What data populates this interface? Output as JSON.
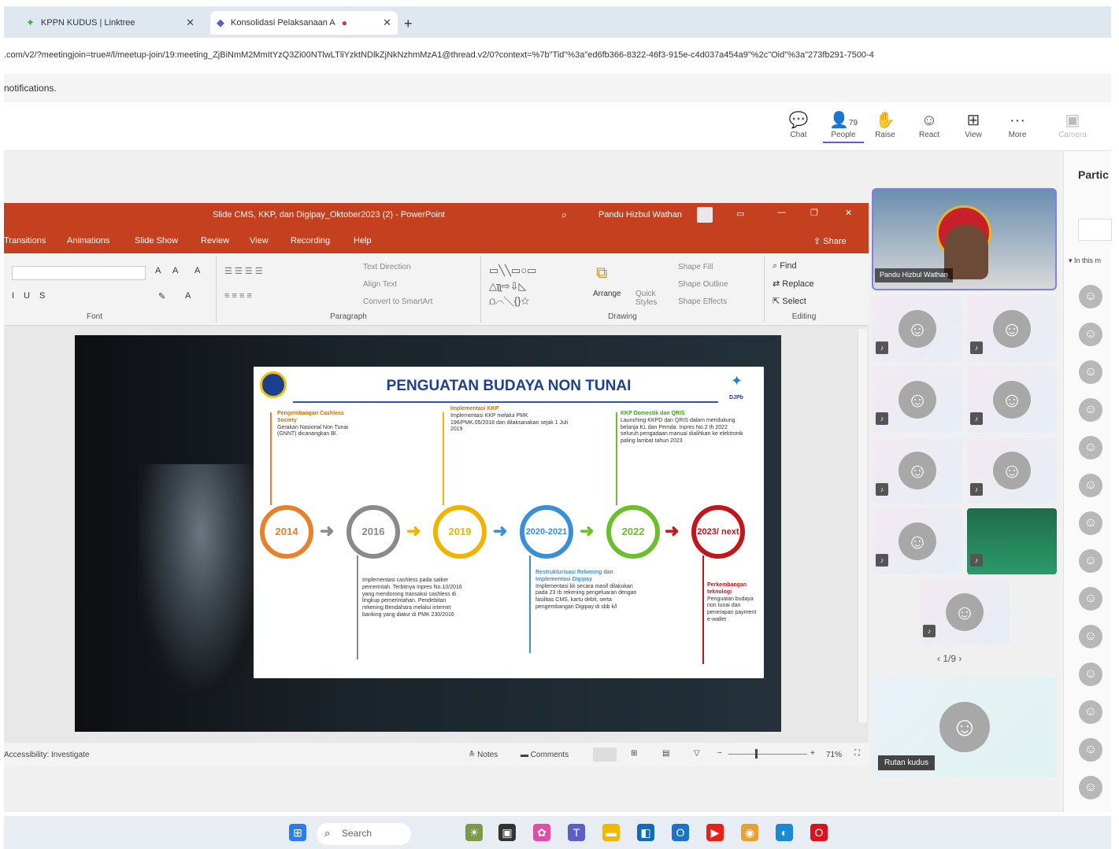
{
  "browser": {
    "tabs": [
      {
        "label": "KPPN KUDUS | Linktree"
      },
      {
        "label": "Konsolidasi Pelaksanaan A"
      }
    ],
    "url": ".com/v2/?meetingjoin=true#/l/meetup-join/19:meeting_ZjBiNmM2MmItYzQ3Zi00NTlwLTliYzktNDlkZjNkNzhmMzA1@thread.v2/0?context=%7b\"Tid\"%3a\"ed6fb366-8322-46f3-915e-c4d037a454a9\"%2c\"Oid\"%3a\"273fb291-7500-4",
    "notification": "notifications."
  },
  "teams": {
    "toolbar": [
      {
        "label": "Chat",
        "icon": "chat-icon"
      },
      {
        "label": "People",
        "icon": "people-icon",
        "count": "79"
      },
      {
        "label": "Raise",
        "icon": "hand-icon"
      },
      {
        "label": "React",
        "icon": "smile-icon"
      },
      {
        "label": "View",
        "icon": "grid-icon"
      },
      {
        "label": "More",
        "icon": "more-icon"
      },
      {
        "label": "Camera",
        "icon": "camera-icon"
      }
    ],
    "panel_title": "Partic",
    "panel_search": "In this m",
    "speaker_name": "Pandu Hizbul Wathan",
    "bottom_tile_name": "Rutan kudus",
    "pager": "1/9",
    "accent": "#5b5fc7"
  },
  "powerpoint": {
    "title": "Slide CMS, KKP, dan Digipay_Oktober2023 (2)  -  PowerPoint",
    "user": "Pandu Hizbul Wathan",
    "menu": [
      "Transitions",
      "Animations",
      "Slide Show",
      "Review",
      "View",
      "Recording",
      "Help"
    ],
    "share": "Share",
    "ribbon": {
      "font_label": "Font",
      "paragraph_label": "Paragraph",
      "drawing_label": "Drawing",
      "editing_label": "Editing",
      "text_direction": "Text Direction",
      "align_text": "Align Text",
      "convert_smartart": "Convert to SmartArt",
      "arrange": "Arrange",
      "quick_styles": "Quick Styles",
      "shape_fill": "Shape Fill",
      "shape_outline": "Shape Outline",
      "shape_effects": "Shape Effects",
      "find": "Find",
      "replace": "Replace",
      "select": "Select"
    },
    "status": {
      "accessibility": "Accessibility: Investigate",
      "notes": "Notes",
      "comments": "Comments",
      "zoom": "71%"
    },
    "brand_color": "#c4401f"
  },
  "slide": {
    "title": "PENGUATAN BUDAYA NON TUNAI",
    "brand": "DJPb",
    "timeline": [
      {
        "year": "2014",
        "color": "#e8812a"
      },
      {
        "year": "2016",
        "color": "#8a8a8a"
      },
      {
        "year": "2019",
        "color": "#f0b400"
      },
      {
        "year": "2020-2021",
        "color": "#3a8fd8"
      },
      {
        "year": "2022",
        "color": "#6bbf2a"
      },
      {
        "year": "2023/ next",
        "color": "#c3151c"
      }
    ],
    "notes": {
      "n2014": {
        "head": "Pengembangan Cashless Society",
        "body": "Gerakan Nasional Non Tunai (GNNT) dicanangkan BI."
      },
      "n2016": {
        "head": "",
        "body": "Implementasi cashless pada satker pemerintah. Terbitnya Inpres No.10/2016 yang mendorong transaksi cashless di lingkup pemerintahan. Pendebitan rekening Bendahara melalui internet banking yang diatur di PMK 230/2016"
      },
      "n2019": {
        "head": "Implementasi KKP",
        "body": "Implementasi KKP melalui PMK 196/PMK.05/2018 dan dilaksanakan sejak 1 Juli 2019"
      },
      "n2021": {
        "head": "Restrukturisasi Rekening dan Implementasi Digipay",
        "body": "Implementasi kk secara masif dilakukan pada 23 rb rekening pengeluaran dengan fasilitas CMS, kartu debit, serta pengembangan Digipay di sbb k/l"
      },
      "n2022": {
        "head": "KKP Domestik dan QRIS",
        "body": "Launching KKPD dan QRIS dalam mendukung belanja KL dan Pemda. Inpres No.2 th 2022 seluruh pengadaan manual dialihkan ke elektronik paling lambat tahun 2023"
      },
      "n2023": {
        "head": "Perkembangan teknologi",
        "body": "Penguatan budaya non tunai dan penerapan payment e-wallet"
      }
    }
  },
  "taskbar": {
    "search": "Search"
  }
}
